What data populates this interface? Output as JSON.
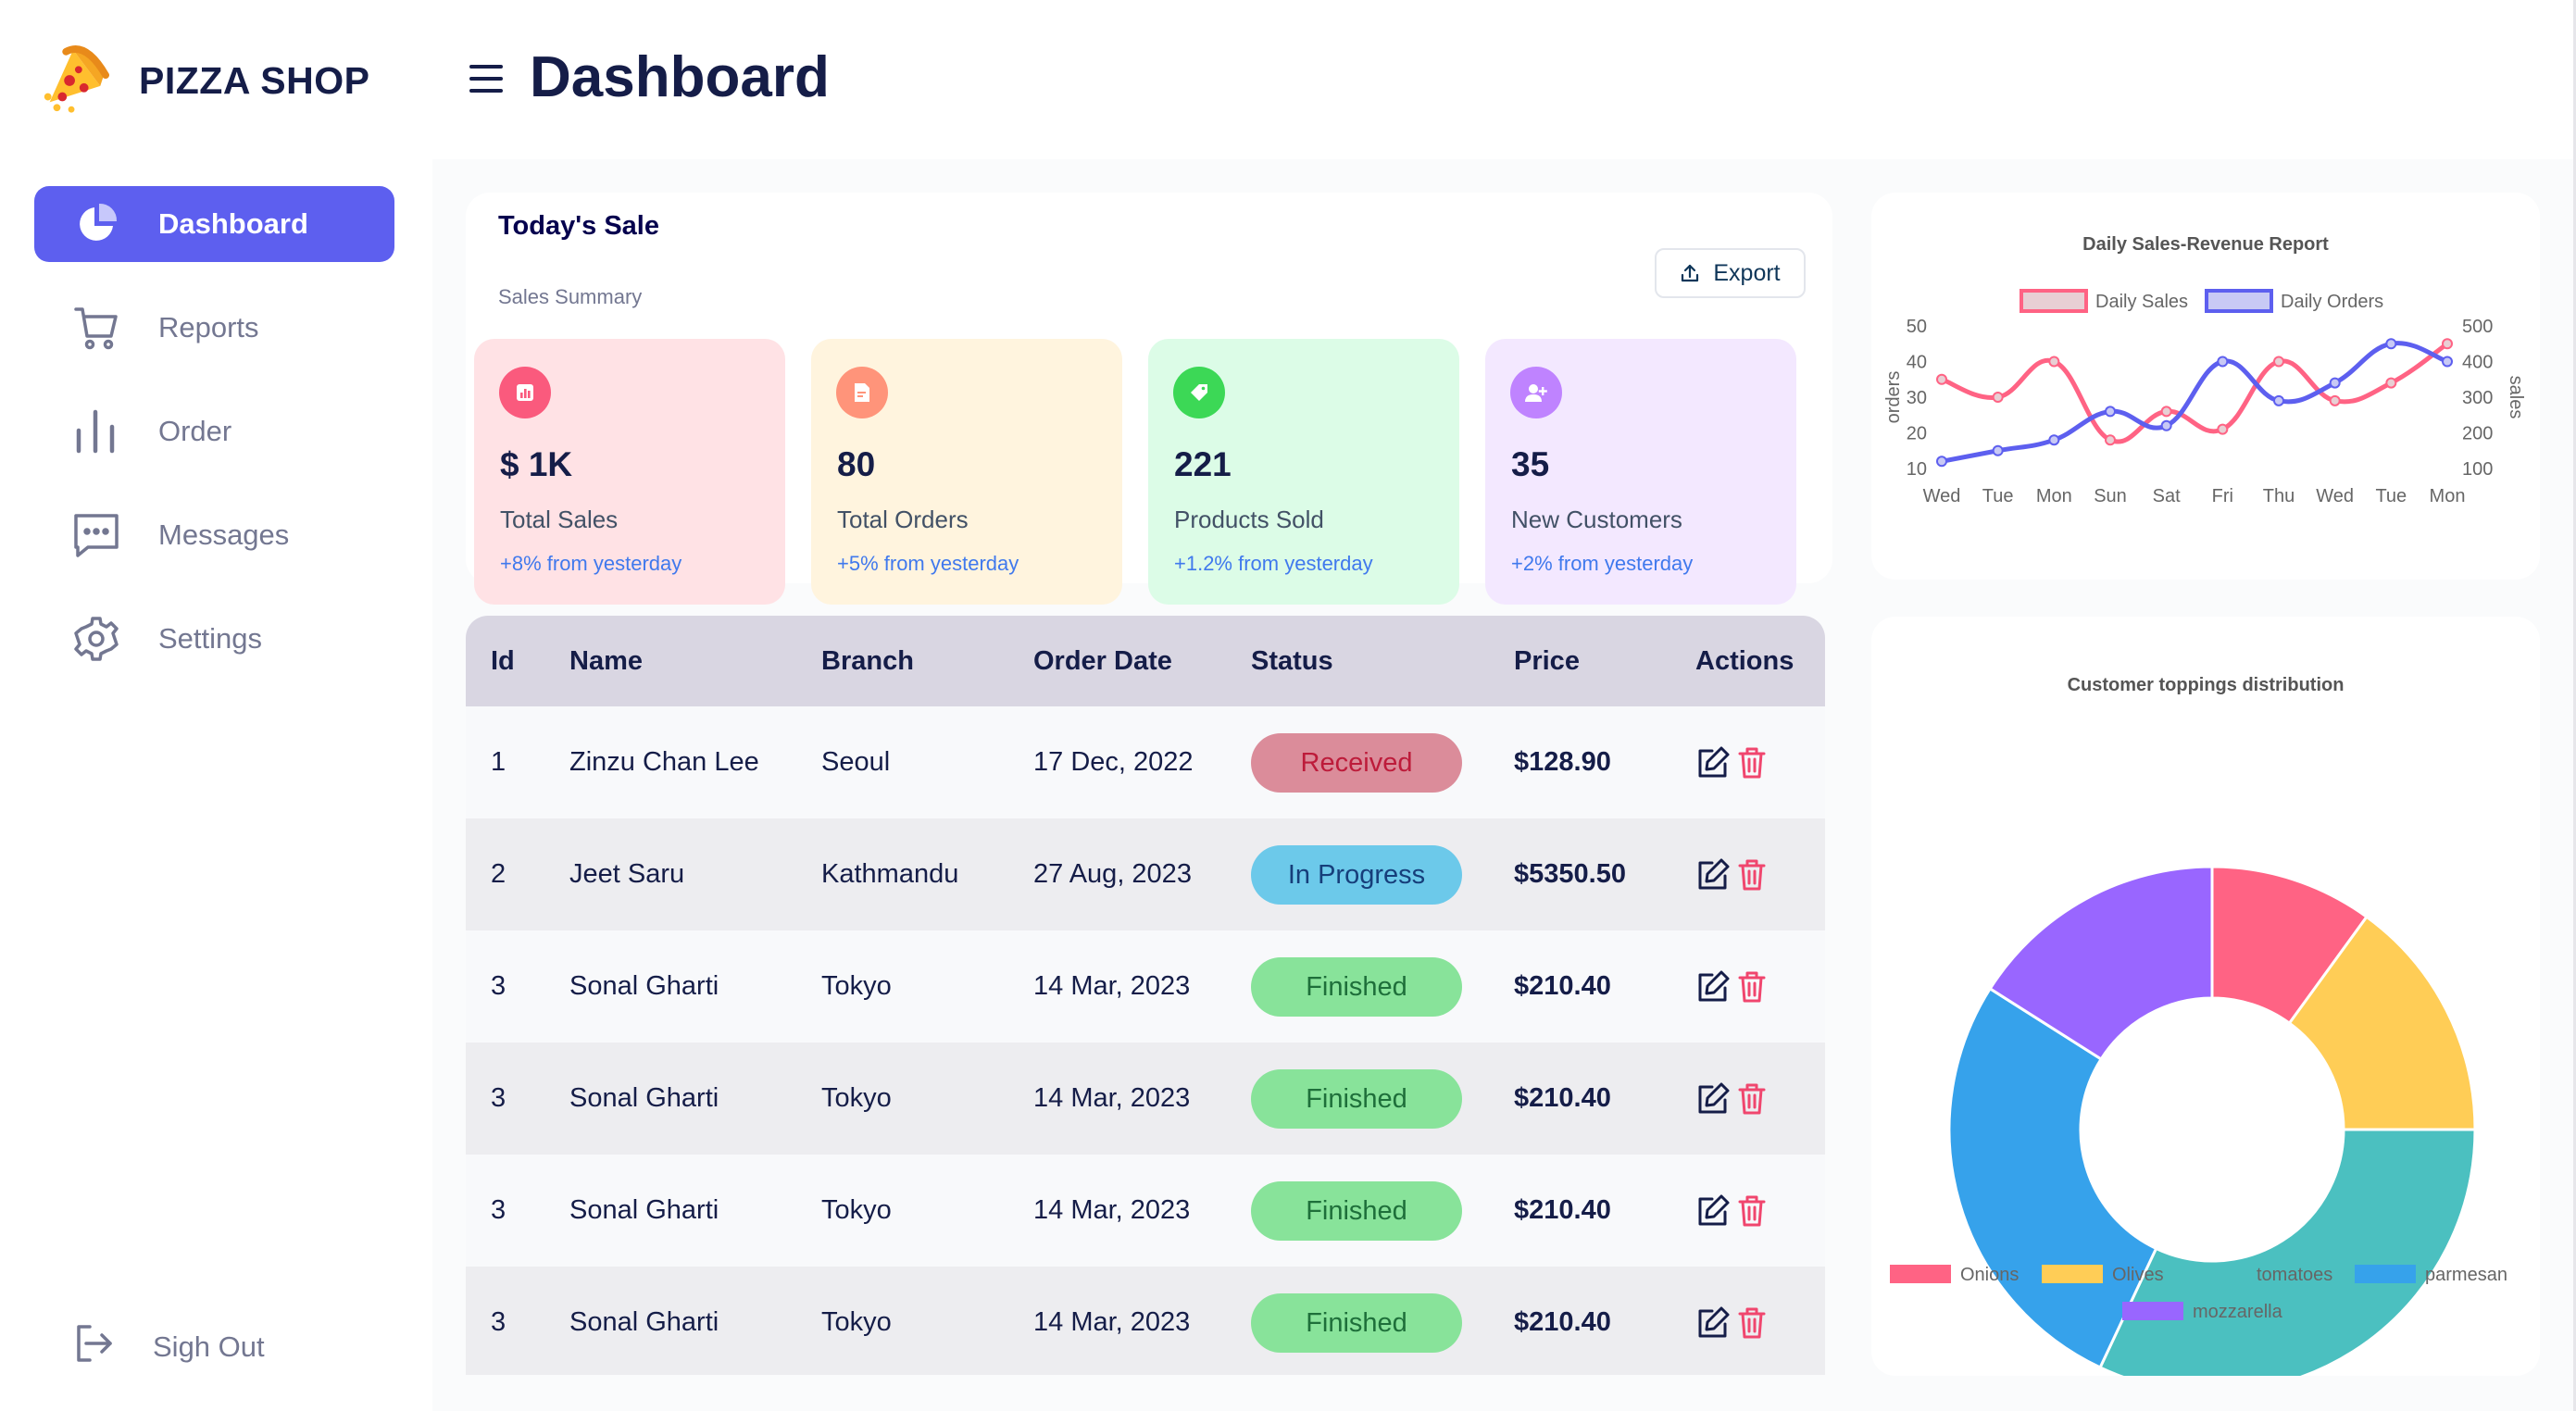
{
  "brand": {
    "name": "PIZZA SHOP"
  },
  "header": {
    "title": "Dashboard"
  },
  "nav": {
    "items": [
      {
        "label": "Dashboard",
        "icon": "pie-chart-icon"
      },
      {
        "label": "Reports",
        "icon": "cart-icon"
      },
      {
        "label": "Order",
        "icon": "bar-chart-icon"
      },
      {
        "label": "Messages",
        "icon": "message-icon"
      },
      {
        "label": "Settings",
        "icon": "gear-icon"
      }
    ],
    "signout": "Sigh Out"
  },
  "sales": {
    "title": "Today's Sale",
    "subtitle": "Sales Summary",
    "export": "Export",
    "stats": [
      {
        "value": "$ 1K",
        "label": "Total Sales",
        "change": "+8% from yesterday",
        "bg": "#ffe2e5",
        "accent": "#fa5a7d",
        "icon": "bar-chart-icon"
      },
      {
        "value": "80",
        "label": "Total Orders",
        "change": "+5% from yesterday",
        "bg": "#fff4de",
        "accent": "#ff947a",
        "icon": "document-icon"
      },
      {
        "value": "221",
        "label": "Products Sold",
        "change": "+1.2% from yesterday",
        "bg": "#dcfce7",
        "accent": "#3cd856",
        "icon": "tag-icon"
      },
      {
        "value": "35",
        "label": "New Customers",
        "change": "+2% from yesterday",
        "bg": "#f3e8ff",
        "accent": "#bf83ff",
        "icon": "add-user-icon"
      }
    ]
  },
  "orders": {
    "columns": [
      "Id",
      "Name",
      "Branch",
      "Order Date",
      "Status",
      "Price",
      "Actions"
    ],
    "rows": [
      {
        "id": "1",
        "name": "Zinzu Chan Lee",
        "branch": "Seoul",
        "date": "17 Dec, 2022",
        "status": "Received",
        "status_type": "received",
        "price": "$128.90"
      },
      {
        "id": "2",
        "name": "Jeet Saru",
        "branch": "Kathmandu",
        "date": "27 Aug, 2023",
        "status": "In Progress",
        "status_type": "inprogress",
        "price": "$5350.50"
      },
      {
        "id": "3",
        "name": "Sonal Gharti",
        "branch": "Tokyo",
        "date": "14 Mar, 2023",
        "status": "Finished",
        "status_type": "finished",
        "price": "$210.40"
      },
      {
        "id": "3",
        "name": "Sonal Gharti",
        "branch": "Tokyo",
        "date": "14 Mar, 2023",
        "status": "Finished",
        "status_type": "finished",
        "price": "$210.40"
      },
      {
        "id": "3",
        "name": "Sonal Gharti",
        "branch": "Tokyo",
        "date": "14 Mar, 2023",
        "status": "Finished",
        "status_type": "finished",
        "price": "$210.40"
      },
      {
        "id": "3",
        "name": "Sonal Gharti",
        "branch": "Tokyo",
        "date": "14 Mar, 2023",
        "status": "Finished",
        "status_type": "finished",
        "price": "$210.40"
      }
    ]
  },
  "chart_data": [
    {
      "type": "line",
      "title": "Daily Sales-Revenue Report",
      "categories": [
        "Wed",
        "Tue",
        "Mon",
        "Sun",
        "Sat",
        "Fri",
        "Thu",
        "Wed",
        "Tue",
        "Mon"
      ],
      "ylabel_left": "orders",
      "ylabel_right": "sales",
      "ylim_left": [
        10,
        50
      ],
      "ylim_right": [
        100,
        500
      ],
      "yticks_left": [
        10,
        20,
        30,
        40,
        50
      ],
      "yticks_right": [
        100,
        200,
        300,
        400,
        500
      ],
      "legend_position": "top",
      "series": [
        {
          "name": "Daily Sales",
          "axis": "right",
          "color": "#ff6384",
          "fill": "#e8cfd4",
          "values": [
            350,
            300,
            400,
            180,
            260,
            210,
            400,
            290,
            340,
            450
          ]
        },
        {
          "name": "Daily Orders",
          "axis": "left",
          "color": "#5d5fef",
          "fill": "#c8c9f5",
          "values": [
            12,
            15,
            18,
            26,
            22,
            40,
            29,
            34,
            45,
            40
          ]
        }
      ]
    },
    {
      "type": "pie",
      "title": "Customer toppings distribution",
      "legend_position": "bottom",
      "slices": [
        {
          "label": "Onions",
          "value": 10,
          "color": "#ff6384"
        },
        {
          "label": "Olives",
          "value": 15,
          "color": "#ffcd56"
        },
        {
          "label": "tomatoes",
          "value": 32,
          "color": "#4bc0c0"
        },
        {
          "label": "parmesan",
          "value": 27,
          "color": "#36a2eb"
        },
        {
          "label": "mozzarella",
          "value": 16,
          "color": "#9966ff"
        }
      ]
    }
  ]
}
